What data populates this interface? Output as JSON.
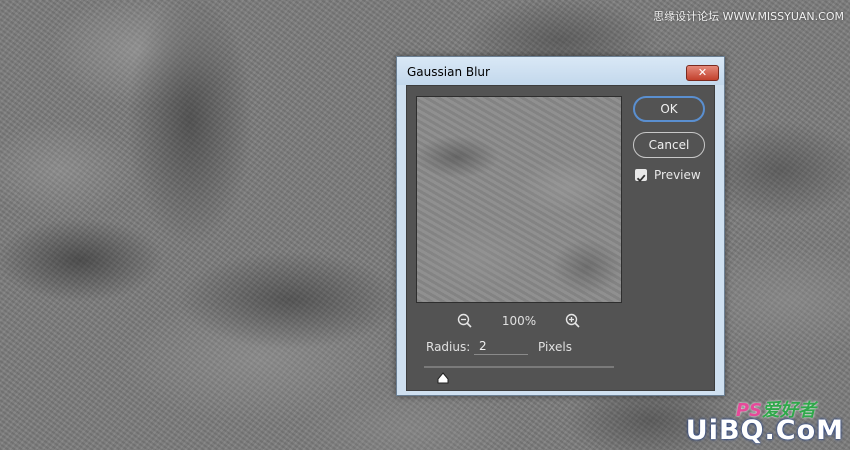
{
  "watermark": {
    "top_text": "思缘设计论坛 WWW.MISSYUAN.COM",
    "logo_ps": "PS",
    "logo_ps_cn": "爱好者",
    "logo_main": "UiBQ.CoM"
  },
  "dialog": {
    "title": "Gaussian Blur",
    "close_glyph": "✕",
    "zoom": {
      "level": "100%"
    },
    "radius": {
      "label": "Radius:",
      "value": "2",
      "unit": "Pixels",
      "slider_fraction": 0.1
    },
    "buttons": {
      "ok": "OK",
      "cancel": "Cancel"
    },
    "preview": {
      "label": "Preview",
      "checked": true
    }
  },
  "icons": {
    "zoom_out": "zoom-out-icon",
    "zoom_in": "zoom-in-icon",
    "checkmark": "checkmark-icon",
    "slider_thumb": "triangle-thumb-icon"
  },
  "colors": {
    "dialog_body": "#535353",
    "ok_focus_ring": "#5a8fd0",
    "close_button": "#c2412d"
  }
}
